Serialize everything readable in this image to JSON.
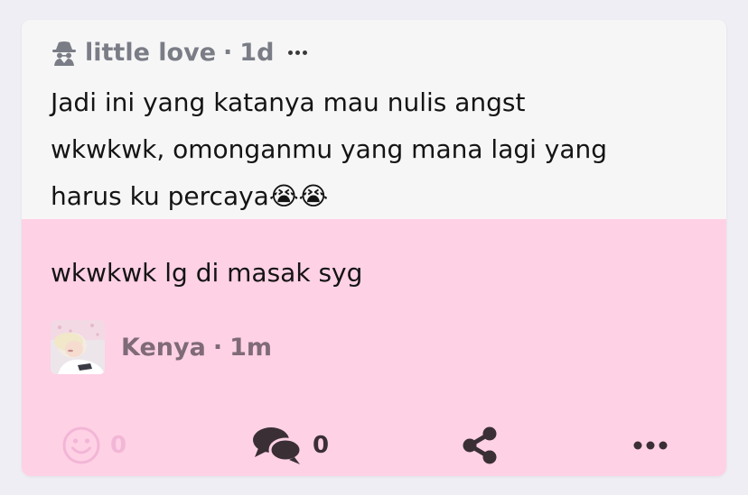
{
  "colors": {
    "background": "#efeef4",
    "question_bg": "#f6f6f6",
    "answer_bg": "#ffd1e5",
    "meta_grey": "#7a7d86",
    "icon_dark": "#3a2f35",
    "like_pink": "#f2b6d6"
  },
  "question": {
    "author": "little love",
    "separator": "·",
    "time": "1d",
    "author_icon": "spy-icon",
    "more_icon": "ellipsis-icon",
    "lines": [
      "Jadi ini yang katanya mau nulis angst",
      "wkwkwk, omonganmu yang mana lagi yang",
      "harus ku percaya😭😭"
    ]
  },
  "answer": {
    "text": "wkwkwk lg di masak syg",
    "responder": {
      "name": "Kenya",
      "separator": "·",
      "time": "1m",
      "avatar_icon": "avatar-photo"
    }
  },
  "actions": {
    "like": {
      "icon": "smiley-icon",
      "count": "0"
    },
    "comment": {
      "icon": "comments-icon",
      "count": "0"
    },
    "share": {
      "icon": "share-icon"
    },
    "more": {
      "icon": "ellipsis-icon"
    }
  }
}
